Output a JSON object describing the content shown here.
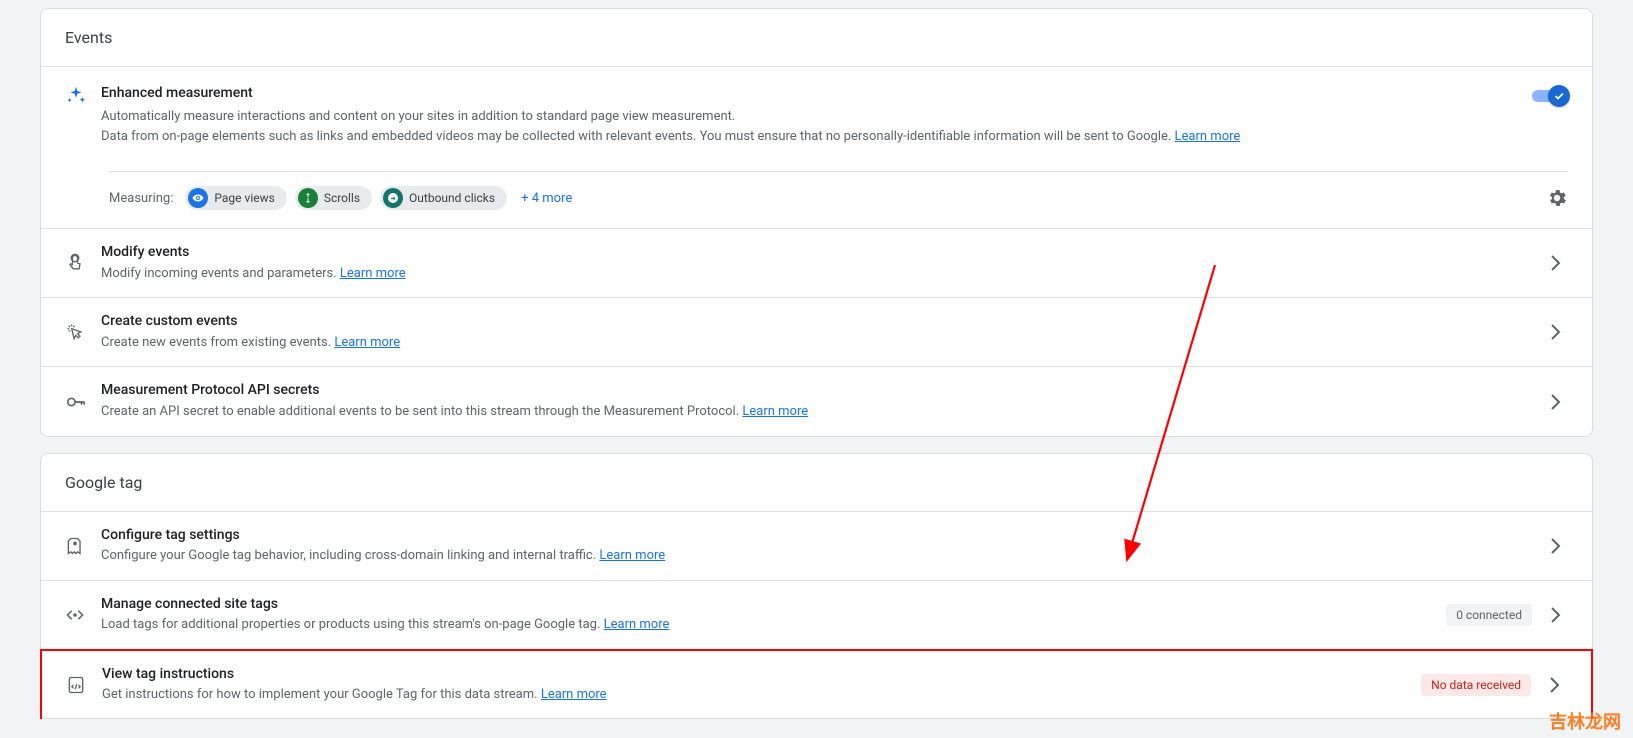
{
  "events": {
    "header": "Events",
    "enhanced": {
      "title": "Enhanced measurement",
      "desc1": "Automatically measure interactions and content on your sites in addition to standard page view measurement.",
      "desc2": "Data from on-page elements such as links and embedded videos may be collected with relevant events. You must ensure that no personally-identifiable information will be sent to Google. ",
      "learn": "Learn more",
      "measuring_label": "Measuring:",
      "chips": {
        "page_views": "Page views",
        "scrolls": "Scrolls",
        "outbound": "Outbound clicks"
      },
      "more": "+ 4 more"
    },
    "modify": {
      "title": "Modify events",
      "sub": "Modify incoming events and parameters. ",
      "learn": "Learn more"
    },
    "custom": {
      "title": "Create custom events",
      "sub": "Create new events from existing events. ",
      "learn": "Learn more"
    },
    "mp": {
      "title": "Measurement Protocol API secrets",
      "sub": "Create an API secret to enable additional events to be sent into this stream through the Measurement Protocol. ",
      "learn": "Learn more"
    }
  },
  "gtag": {
    "header": "Google tag",
    "configure": {
      "title": "Configure tag settings",
      "sub": "Configure your Google tag behavior, including cross-domain linking and internal traffic. ",
      "learn": "Learn more"
    },
    "connected": {
      "title": "Manage connected site tags",
      "sub": "Load tags for additional properties or products using this stream's on-page Google tag. ",
      "learn": "Learn more",
      "badge": "0 connected"
    },
    "view": {
      "title": "View tag instructions",
      "sub": "Get instructions for how to implement your Google Tag for this data stream. ",
      "learn": "Learn more",
      "badge": "No data received"
    }
  },
  "watermark": "吉林龙网"
}
